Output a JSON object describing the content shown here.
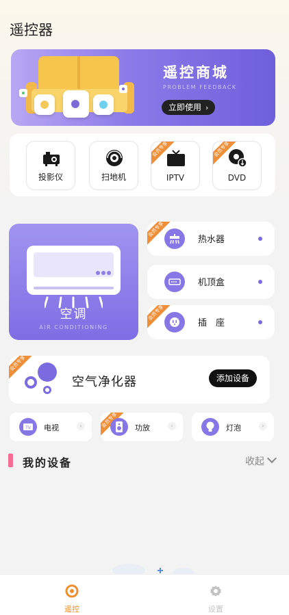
{
  "header": {
    "title": "遥控器"
  },
  "banner": {
    "title": "遥控商城",
    "subtitle": "PROBLEM FEEDBACK",
    "button_label": "立即使用",
    "button_chevron": "›"
  },
  "badge": {
    "vip_label": "会员专享"
  },
  "devices_top": [
    {
      "label": "投影仪",
      "icon": "projector-icon",
      "vip": false
    },
    {
      "label": "扫地机",
      "icon": "robot-vacuum-icon",
      "vip": false
    },
    {
      "label": "IPTV",
      "icon": "tv-icon",
      "vip": true
    },
    {
      "label": "DVD",
      "icon": "dvd-icon",
      "vip": true
    }
  ],
  "ac_card": {
    "title": "空调",
    "subtitle": "AIR CONDITIONING"
  },
  "right_list": [
    {
      "label": "热水器",
      "icon": "water-heater-icon",
      "vip": true
    },
    {
      "label": "机顶盒",
      "icon": "set-top-box-icon",
      "vip": false
    },
    {
      "label": "插　座",
      "icon": "socket-icon",
      "vip": true
    }
  ],
  "purifier": {
    "label": "空气净化器",
    "button_label": "添加设备",
    "vip": true
  },
  "small_cards": [
    {
      "label": "电视",
      "icon": "tv-icon",
      "vip": false
    },
    {
      "label": "功放",
      "icon": "speaker-icon",
      "vip": true
    },
    {
      "label": "灯泡",
      "icon": "bulb-icon",
      "vip": false
    }
  ],
  "my_devices": {
    "title": "我的设备",
    "collapse_label": "收起"
  },
  "tabbar": [
    {
      "label": "遥控",
      "icon": "remote-icon",
      "active": true
    },
    {
      "label": "设置",
      "icon": "gear-icon",
      "active": false
    }
  ],
  "colors": {
    "accent": "#7a6ce0",
    "active_tab": "#f08d2c",
    "vip_badge": "#ef8f3a",
    "section_bar": "#f36d95"
  }
}
